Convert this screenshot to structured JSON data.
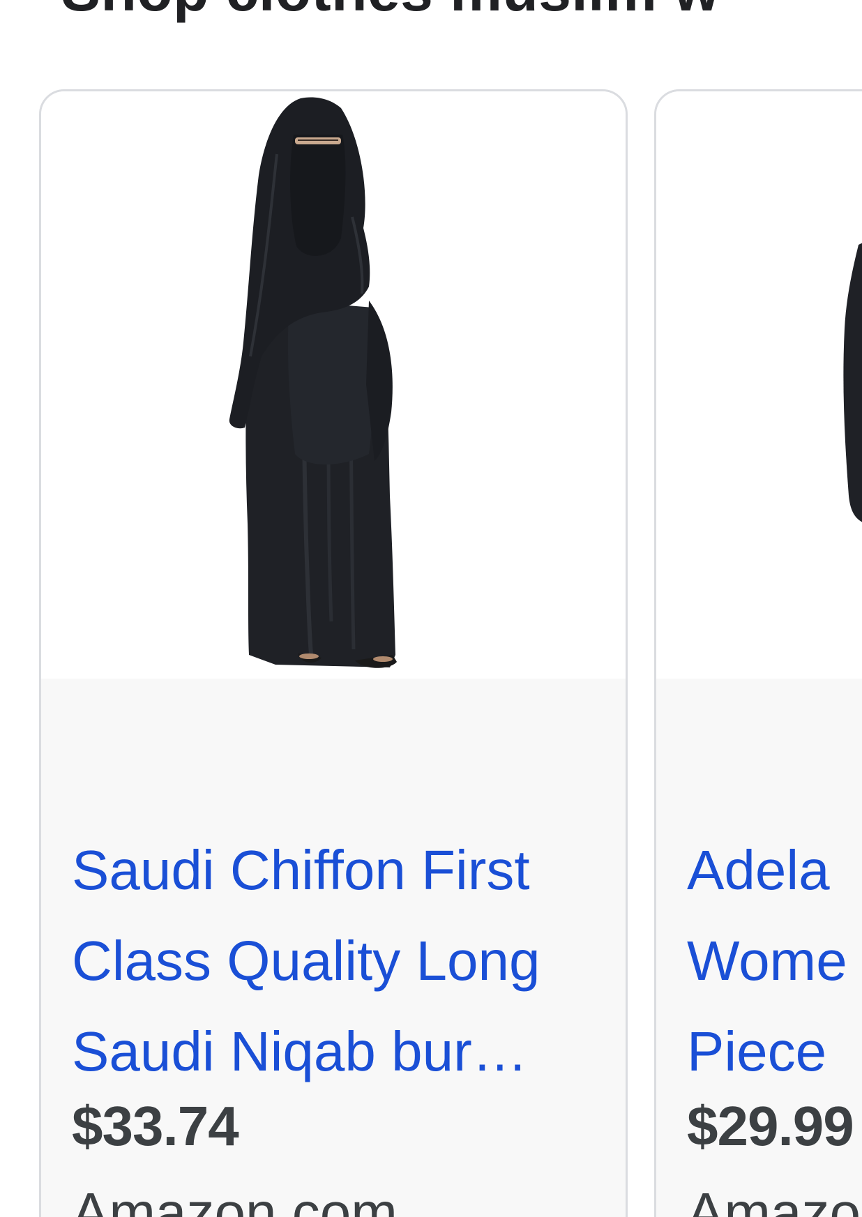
{
  "section": {
    "heading": "Shop clothes muslim w"
  },
  "products": [
    {
      "title_lines": [
        "Saudi Chiffon First",
        "Class Quality Long",
        "Saudi Niqab bur…"
      ],
      "price": "$33.74",
      "store": "Amazon.com"
    },
    {
      "title_lines": [
        "Adela",
        "Wome",
        "Piece"
      ],
      "price": "$29.99",
      "store": "Amazo"
    }
  ],
  "colors": {
    "link": "#1a4fd6",
    "text": "#3c4043",
    "card_border": "#dadce0",
    "card_body_bg": "#f8f8f8",
    "garment": "#1f2126"
  }
}
